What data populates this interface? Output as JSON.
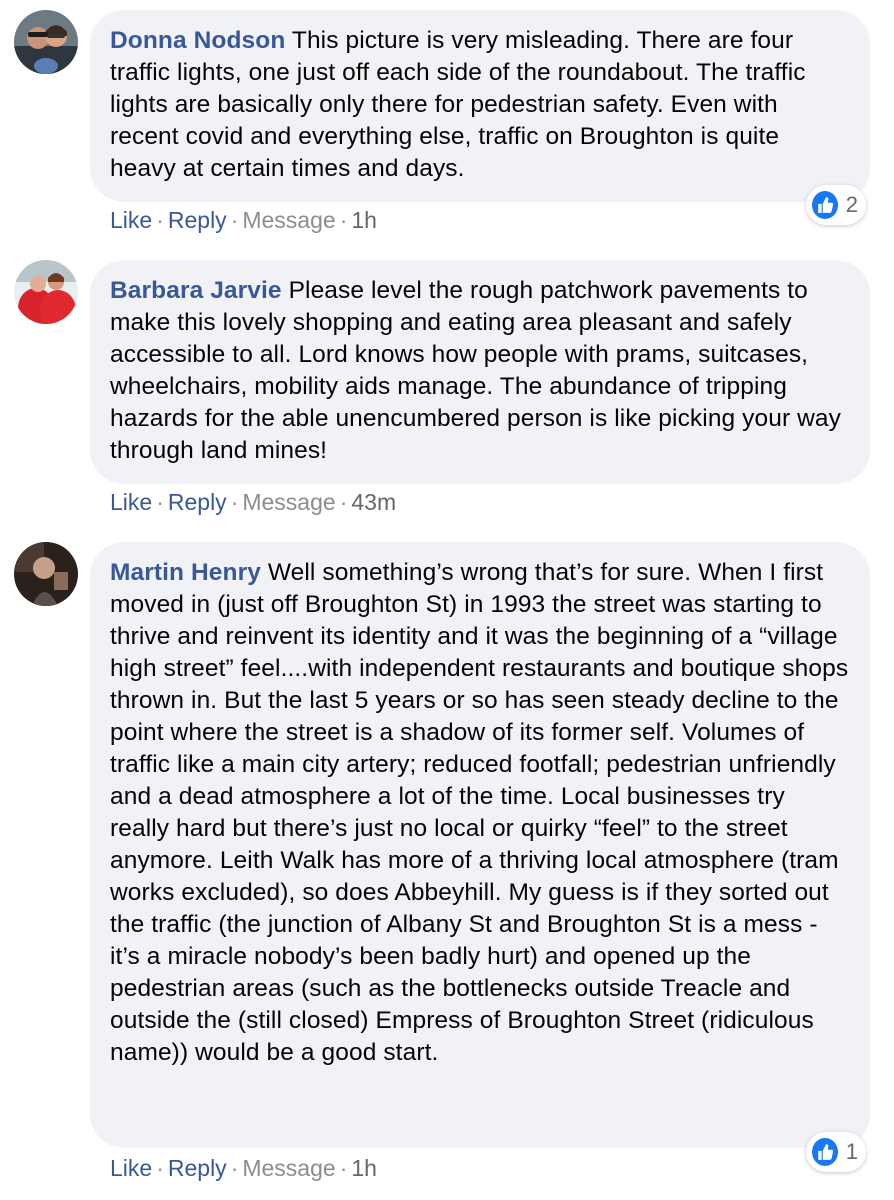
{
  "comments": [
    {
      "author": "Donna Nodson",
      "text": "This picture is very misleading. There are four traffic lights, one just off each side of the roundabout. The traffic lights are basically only there for pedestrian safety. Even with recent covid and everything else, traffic on Broughton is quite heavy at certain times and days.",
      "like_label": "Like",
      "reply_label": "Reply",
      "message_label": "Message",
      "time": "1h",
      "reaction_icon": "like-icon",
      "reaction_count": "2"
    },
    {
      "author": "Barbara Jarvie",
      "text": "Please level the rough patchwork pavements to make this lovely shopping and eating area pleasant and safely accessible to all. Lord knows how people with prams, suitcases, wheelchairs, mobility aids manage. The abundance of tripping hazards for the able unencumbered person is like picking your way through land mines!",
      "like_label": "Like",
      "reply_label": "Reply",
      "message_label": "Message",
      "time": "43m"
    },
    {
      "author": "Martin Henry",
      "text": "Well something’s wrong that’s for sure. When I first moved in (just off Broughton St) in 1993 the street was starting to thrive and reinvent its identity and it was the beginning of a “village high street” feel....with independent restaurants and boutique shops thrown in. But the last 5 years or so has seen steady decline to the point where the street is a shadow of its former self. Volumes of traffic like a main city artery; reduced footfall; pedestrian unfriendly and a dead atmosphere a lot of the time. Local businesses try really hard but there’s just no local or quirky “feel” to the street anymore. Leith Walk has more of a thriving local atmosphere (tram works excluded), so does Abbeyhill. My guess is if they sorted out the traffic (the junction of Albany St and Broughton St is a mess - it’s a miracle nobody’s been badly hurt) and opened up the pedestrian areas (such as the bottlenecks outside Treacle and outside the (still closed) Empress of Broughton Street (ridiculous name)) would be a good start.",
      "like_label": "Like",
      "reply_label": "Reply",
      "message_label": "Message",
      "time": "1h",
      "reaction_icon": "like-icon",
      "reaction_count": "1"
    }
  ],
  "colors": {
    "author": "#385898",
    "bubble": "#f0f2f5",
    "like_blue": "#1877f2",
    "meta_gray": "#65676b"
  }
}
